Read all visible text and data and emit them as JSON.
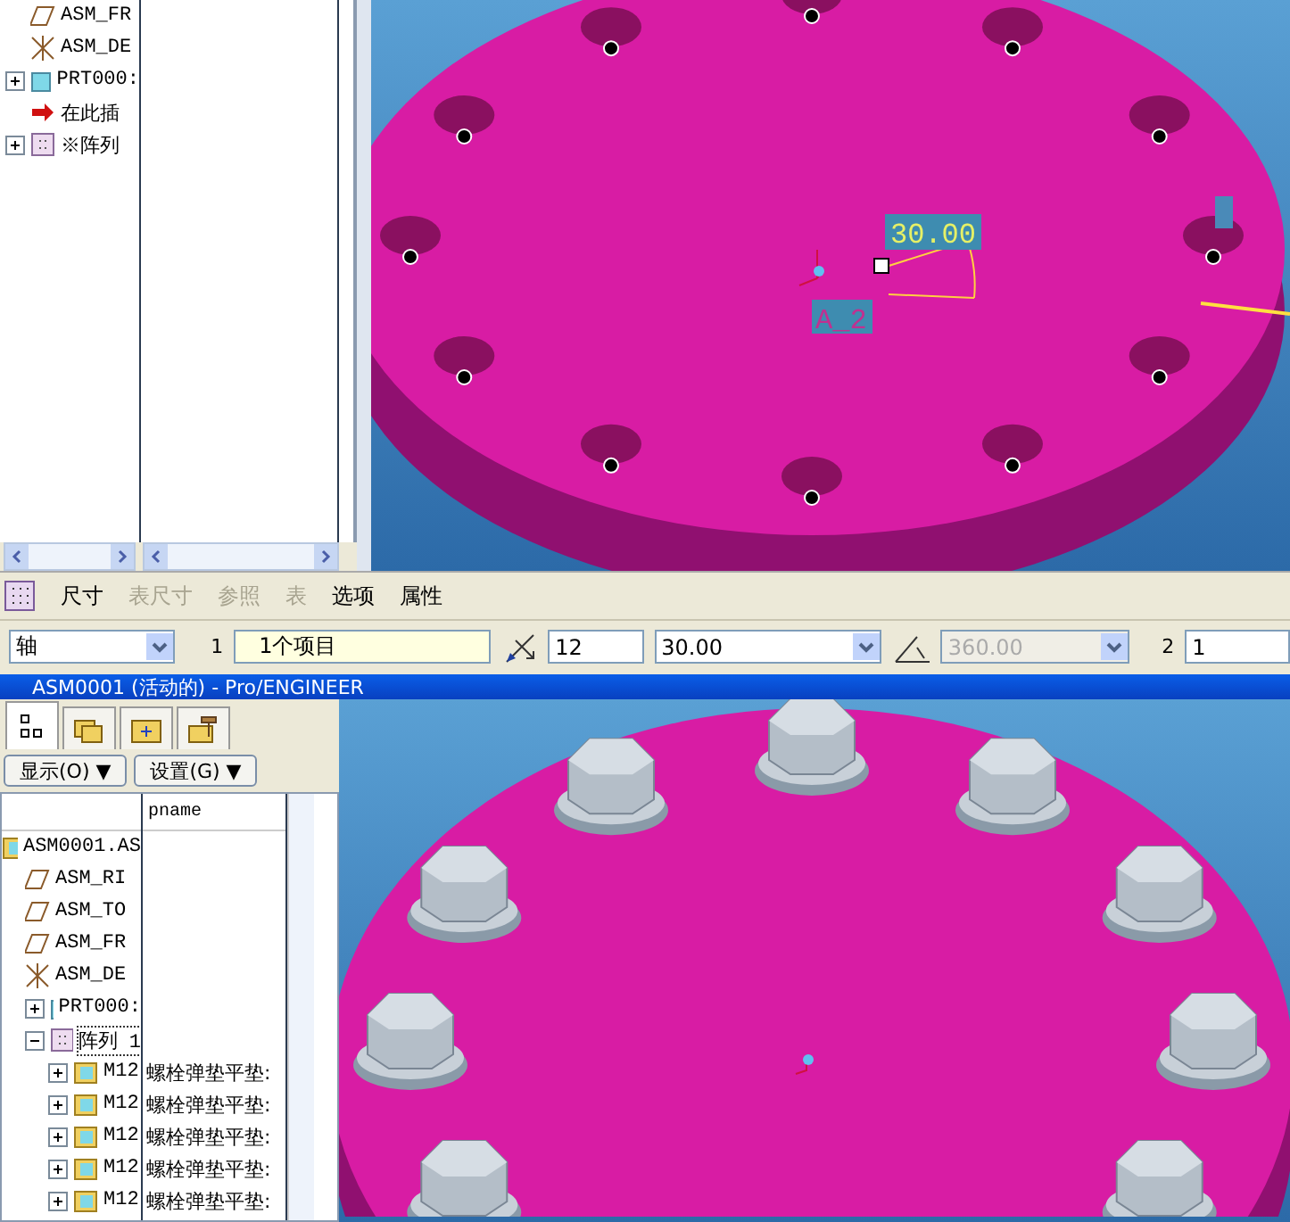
{
  "top_tree": {
    "items": [
      {
        "label": "ASM_FR",
        "kind": "plane",
        "expandable": false
      },
      {
        "label": "ASM_DE",
        "kind": "csys",
        "expandable": false
      },
      {
        "label": "PRT000:",
        "kind": "part",
        "expandable": true
      },
      {
        "label": "在此插",
        "kind": "insert",
        "expandable": false
      },
      {
        "label": "※阵列",
        "kind": "pattern",
        "expandable": true
      }
    ]
  },
  "top_view": {
    "dimension": "30.00",
    "axis_label": "A_2"
  },
  "dashboard": {
    "tabs": [
      {
        "label": "尺寸",
        "disabled": false
      },
      {
        "label": "表尺寸",
        "disabled": true
      },
      {
        "label": "参照",
        "disabled": true
      },
      {
        "label": "表",
        "disabled": true
      },
      {
        "label": "选项",
        "disabled": false
      },
      {
        "label": "属性",
        "disabled": false
      }
    ],
    "type_select": "轴",
    "first_index": "1",
    "first_refs": "1个项目",
    "count": "12",
    "increment": "30.00",
    "total_angle": "360.00",
    "second_index": "2",
    "second_count": "1"
  },
  "window_title": "ASM0001 (活动的) - Pro/ENGINEER",
  "model_tree": {
    "tabs": [
      {
        "kind": "tree",
        "selected": true
      },
      {
        "kind": "folders",
        "selected": false
      },
      {
        "kind": "favorites",
        "selected": false
      },
      {
        "kind": "tools",
        "selected": false
      }
    ],
    "buttons": [
      "显示(O) ▼",
      "设置(G) ▼"
    ],
    "column": "pname",
    "items": [
      {
        "label": "ASM0001.AS",
        "kind": "assembly",
        "children": [
          {
            "label": "ASM_RI",
            "kind": "plane"
          },
          {
            "label": "ASM_TO",
            "kind": "plane"
          },
          {
            "label": "ASM_FR",
            "kind": "plane"
          },
          {
            "label": "ASM_DE",
            "kind": "csys"
          },
          {
            "label": "PRT000:",
            "kind": "part",
            "expanded": false
          },
          {
            "label": "阵列 1",
            "kind": "pattern",
            "expanded": true,
            "selected": true,
            "children": [
              {
                "label": "M12",
                "kind": "subassembly",
                "expanded": false,
                "pname": "螺栓弹垫平垫:"
              },
              {
                "label": "M12",
                "kind": "subassembly",
                "expanded": false,
                "pname": "螺栓弹垫平垫:"
              },
              {
                "label": "M12",
                "kind": "subassembly",
                "expanded": false,
                "pname": "螺栓弹垫平垫:"
              },
              {
                "label": "M12",
                "kind": "subassembly",
                "expanded": false,
                "pname": "螺栓弹垫平垫:"
              },
              {
                "label": "M12",
                "kind": "subassembly",
                "expanded": false,
                "pname": "螺栓弹垫平垫:"
              }
            ]
          }
        ]
      }
    ]
  }
}
